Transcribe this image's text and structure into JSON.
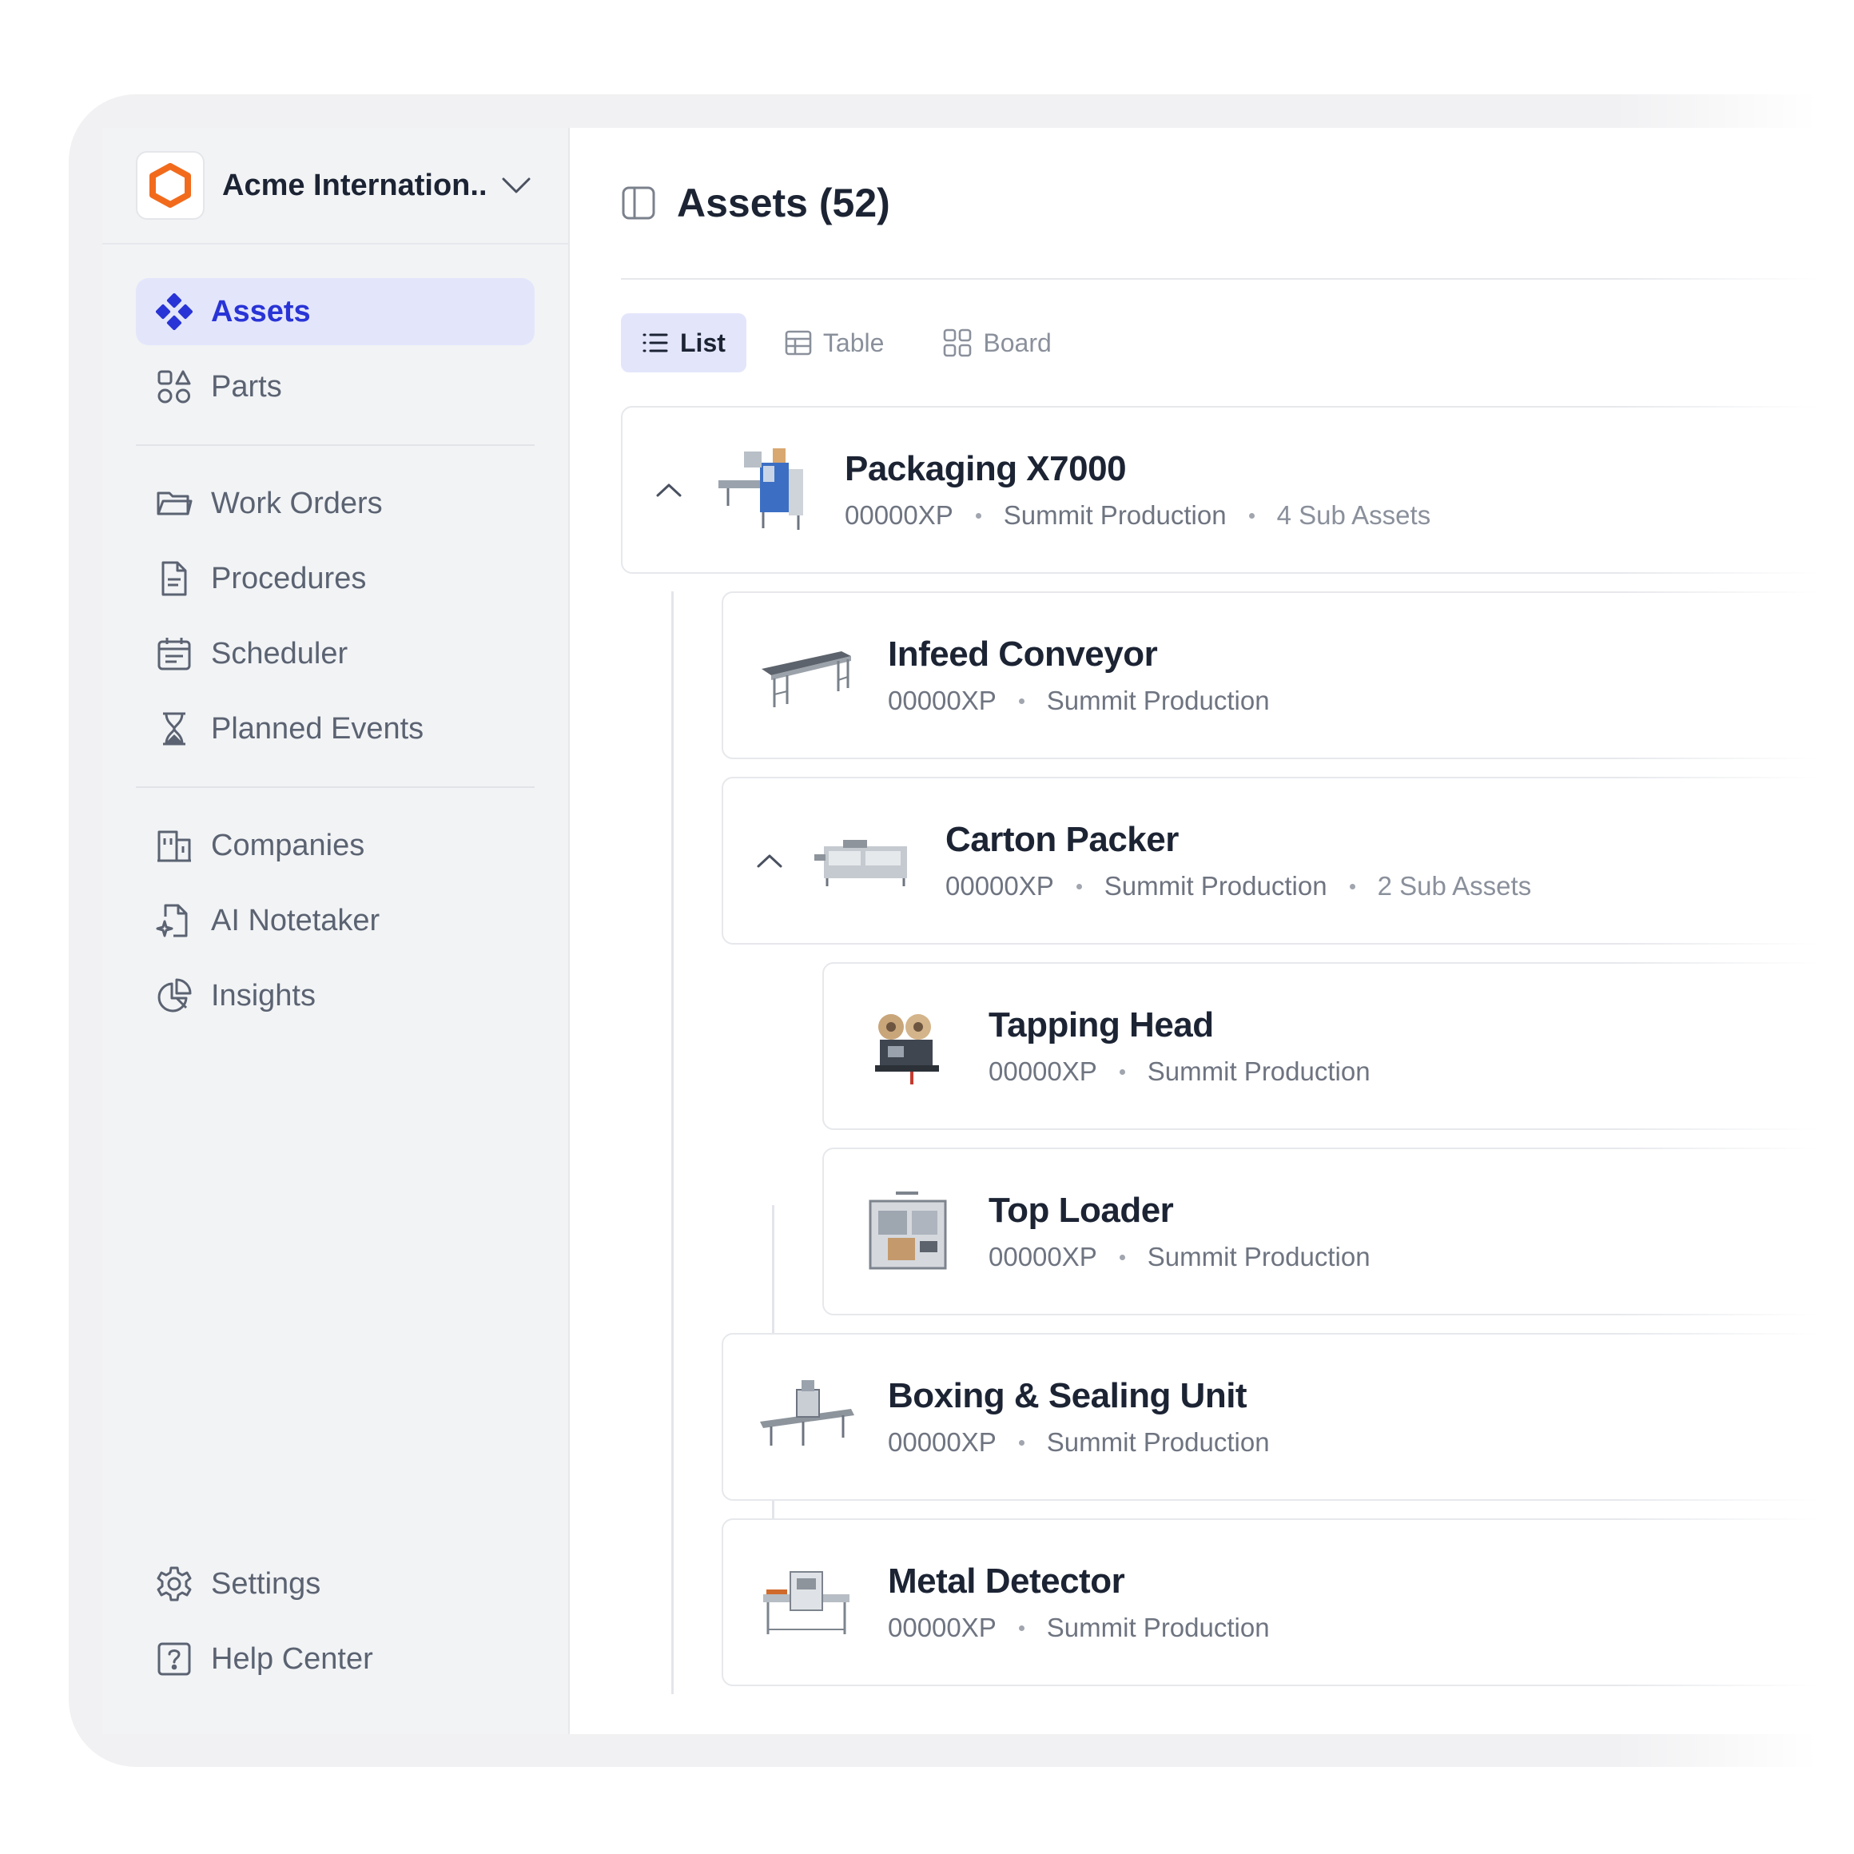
{
  "org": {
    "name": "Acme Internation..."
  },
  "sidebar": {
    "items": [
      {
        "label": "Assets",
        "icon": "assets-icon",
        "active": true
      },
      {
        "label": "Parts",
        "icon": "parts-icon"
      },
      {
        "label": "Work Orders",
        "icon": "folder-icon"
      },
      {
        "label": "Procedures",
        "icon": "document-icon"
      },
      {
        "label": "Scheduler",
        "icon": "calendar-icon"
      },
      {
        "label": "Planned Events",
        "icon": "hourglass-icon"
      },
      {
        "label": "Companies",
        "icon": "building-icon"
      },
      {
        "label": "AI Notetaker",
        "icon": "ai-document-icon"
      },
      {
        "label": "Insights",
        "icon": "pie-chart-icon"
      }
    ],
    "bottom": [
      {
        "label": "Settings",
        "icon": "gear-icon"
      },
      {
        "label": "Help Center",
        "icon": "help-icon"
      }
    ]
  },
  "page": {
    "title": "Assets (52)"
  },
  "views": [
    {
      "label": "List",
      "active": true
    },
    {
      "label": "Table"
    },
    {
      "label": "Board"
    }
  ],
  "assets": [
    {
      "name": "Packaging X7000",
      "code": "00000XP",
      "location": "Summit Production",
      "sub": "4 Sub Assets"
    },
    {
      "name": "Infeed Conveyor",
      "code": "00000XP",
      "location": "Summit Production"
    },
    {
      "name": "Carton Packer",
      "code": "00000XP",
      "location": "Summit Production",
      "sub": "2 Sub Assets"
    },
    {
      "name": "Tapping Head",
      "code": "00000XP",
      "location": "Summit Production"
    },
    {
      "name": "Top Loader",
      "code": "00000XP",
      "location": "Summit Production"
    },
    {
      "name": "Boxing & Sealing Unit",
      "code": "00000XP",
      "location": "Summit Production"
    },
    {
      "name": "Metal Detector",
      "code": "00000XP",
      "location": "Summit Production"
    }
  ],
  "colors": {
    "accent": "#2934d6",
    "accent_bg": "#e3e6fb",
    "brand": "#f26b1d",
    "text": "#1c2434",
    "muted": "#6e7480"
  }
}
